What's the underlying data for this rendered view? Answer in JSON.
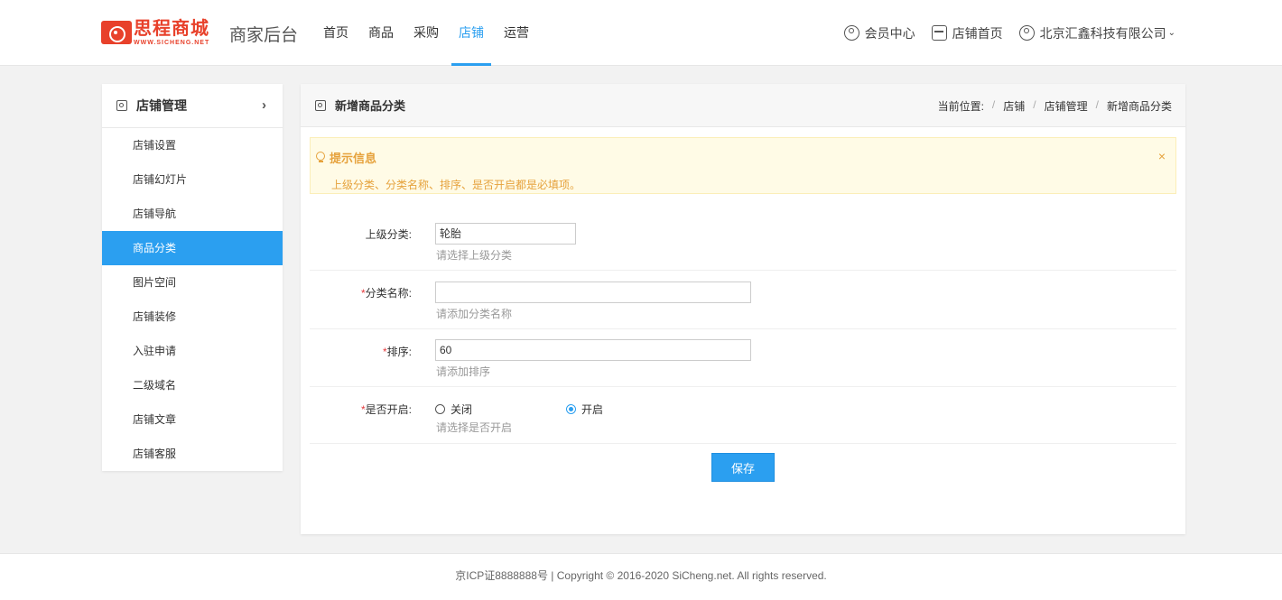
{
  "header": {
    "logo_cn": "思程商城",
    "logo_en": "WWW.SICHENG.NET",
    "title": "商家后台",
    "nav": [
      "首页",
      "商品",
      "采购",
      "店铺",
      "运营"
    ],
    "active_nav": "店铺",
    "member_center": "会员中心",
    "store_home": "店铺首页",
    "company": "北京汇鑫科技有限公司"
  },
  "sidebar": {
    "title": "店铺管理",
    "items": [
      {
        "label": "店铺设置"
      },
      {
        "label": "店铺幻灯片"
      },
      {
        "label": "店铺导航"
      },
      {
        "label": "商品分类"
      },
      {
        "label": "图片空间"
      },
      {
        "label": "店铺装修"
      },
      {
        "label": "入驻申请"
      },
      {
        "label": "二级域名"
      },
      {
        "label": "店铺文章"
      },
      {
        "label": "店铺客服"
      }
    ],
    "active": "商品分类"
  },
  "main": {
    "title": "新增商品分类",
    "breadcrumb": {
      "prefix": "当前位置:",
      "items": [
        "店铺",
        "店铺管理",
        "新增商品分类"
      ]
    },
    "tip": {
      "title": "提示信息",
      "text": "上级分类、分类名称、排序、是否开启都是必填项。",
      "close": "×"
    },
    "form": {
      "parent": {
        "label": "上级分类:",
        "value": "轮胎",
        "hint": "请选择上级分类"
      },
      "name": {
        "required": "*",
        "label": "分类名称:",
        "value": "",
        "hint": "请添加分类名称"
      },
      "sort": {
        "required": "*",
        "label": "排序:",
        "value": "60",
        "hint": "请添加排序"
      },
      "enabled": {
        "required": "*",
        "label": "是否开启:",
        "options": [
          "关闭",
          "开启"
        ],
        "selected": "开启",
        "hint": "请选择是否开启"
      },
      "save": "保存"
    }
  },
  "footer": {
    "text": "京ICP证8888888号 | Copyright © 2016-2020 SiCheng.net. All rights reserved."
  },
  "colors": {
    "accent": "#2b9ff0",
    "tip_text": "#e6a23c",
    "tip_bg": "#fffbe6",
    "logo_red": "#e8412b"
  }
}
